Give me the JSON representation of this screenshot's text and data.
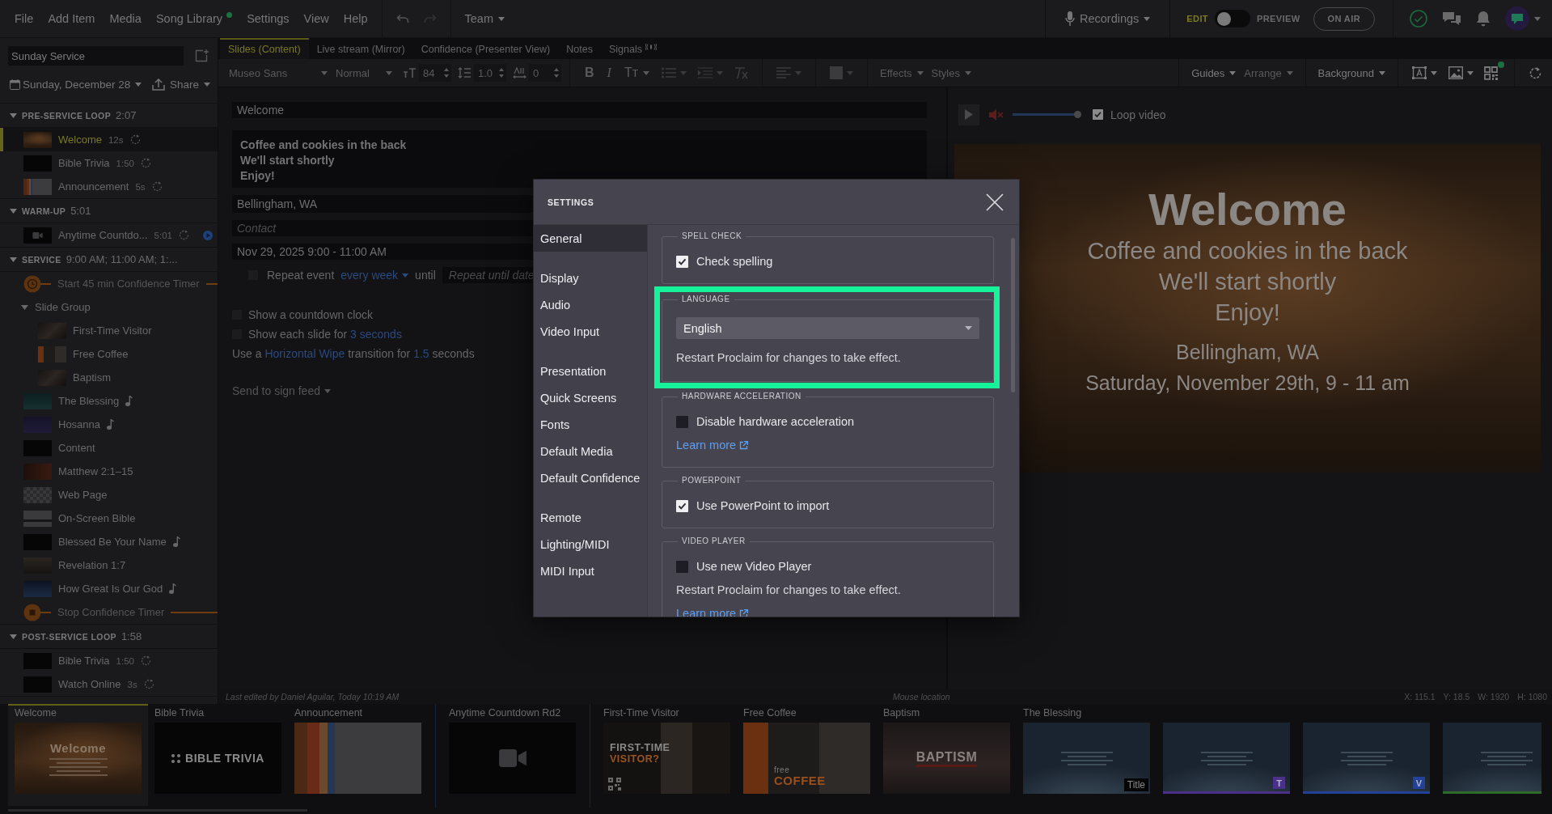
{
  "menu_bar": {
    "menus": [
      {
        "label": "File",
        "notification_dot": false
      },
      {
        "label": "Add Item",
        "notification_dot": false
      },
      {
        "label": "Media",
        "notification_dot": false
      },
      {
        "label": "Song Library",
        "notification_dot": true
      },
      {
        "label": "Settings",
        "notification_dot": false
      },
      {
        "label": "View",
        "notification_dot": false
      },
      {
        "label": "Help",
        "notification_dot": false
      }
    ],
    "team": "Team",
    "recordings": "Recordings",
    "mode": {
      "edit_label": "EDIT",
      "preview_label": "PREVIEW",
      "preview_on": false
    },
    "on_air": "ON AIR"
  },
  "sidebar": {
    "service_name": "Sunday Service",
    "date": "Sunday, December 28",
    "share": "Share",
    "sections": [
      {
        "title": "PRE-SERVICE LOOP",
        "time": "2:07",
        "expanded": true,
        "items": [
          {
            "kind": "slide",
            "label": "Welcome",
            "duration": "12s",
            "thumbnail": {
              "kind": "warm"
            },
            "loop": true,
            "playing": false,
            "selected": true
          },
          {
            "kind": "slide",
            "label": "Bible Trivia",
            "duration": "1:50",
            "thumbnail": {
              "kind": "title"
            },
            "loop": true,
            "playing": false,
            "selected": false
          },
          {
            "kind": "slide",
            "label": "Announcement",
            "duration": "5s",
            "thumbnail": {
              "kind": "poster"
            },
            "loop": true,
            "playing": false,
            "selected": false
          }
        ]
      },
      {
        "title": "WARM-UP",
        "time": "5:01",
        "expanded": true,
        "items": [
          {
            "kind": "slide",
            "label": "Anytime Countdo...",
            "duration": "5:01",
            "thumbnail": {
              "kind": "video"
            },
            "loop": true,
            "playing": true,
            "selected": false
          }
        ]
      },
      {
        "title": "SERVICE",
        "time": "9:00 AM; 11:00 AM; 1:...",
        "expanded": true,
        "items": [
          {
            "kind": "timer-start",
            "label": "Start 45 min Confidence Timer",
            "selected": false
          },
          {
            "kind": "group",
            "label": "Slide Group",
            "expanded": true,
            "selected": false,
            "children": [
              {
                "kind": "slide",
                "label": "First-Time Visitor",
                "thumbnail": {
                  "kind": "photo"
                },
                "selected": false
              },
              {
                "kind": "slide",
                "label": "Free Coffee",
                "thumbnail": {
                  "kind": "coffee"
                },
                "selected": false
              },
              {
                "kind": "slide",
                "label": "Baptism",
                "thumbnail": {
                  "kind": "photo"
                },
                "selected": false
              }
            ]
          },
          {
            "kind": "song",
            "label": "The Blessing",
            "thumbnail": {
              "kind": "teal"
            },
            "selected": false
          },
          {
            "kind": "song",
            "label": "Hosanna",
            "thumbnail": {
              "kind": "purple"
            },
            "selected": false
          },
          {
            "kind": "slide",
            "label": "Content",
            "thumbnail": {
              "kind": "title"
            },
            "selected": false
          },
          {
            "kind": "slide",
            "label": "Matthew 2:1–15",
            "thumbnail": {
              "kind": "red"
            },
            "selected": false
          },
          {
            "kind": "slide",
            "label": "Web Page",
            "thumbnail": {
              "kind": "checker"
            },
            "selected": false
          },
          {
            "kind": "slide",
            "label": "On-Screen Bible",
            "thumbnail": {
              "kind": "screen"
            },
            "selected": false
          },
          {
            "kind": "song",
            "label": "Blessed Be Your Name",
            "thumbnail": {
              "kind": "title"
            },
            "selected": false
          },
          {
            "kind": "slide",
            "label": "Revelation 1:7",
            "thumbnail": {
              "kind": "stone"
            },
            "selected": false
          },
          {
            "kind": "song",
            "label": "How Great Is Our God",
            "thumbnail": {
              "kind": "night"
            },
            "selected": false
          },
          {
            "kind": "timer-stop",
            "label": "Stop Confidence Timer",
            "selected": false
          }
        ]
      },
      {
        "title": "POST-SERVICE LOOP",
        "time": "1:58",
        "expanded": true,
        "items": [
          {
            "kind": "slide",
            "label": "Bible Trivia",
            "duration": "1:50",
            "thumbnail": {
              "kind": "title"
            },
            "loop": true,
            "playing": false,
            "selected": false
          },
          {
            "kind": "slide",
            "label": "Watch Online",
            "duration": "3s",
            "thumbnail": {
              "kind": "title"
            },
            "loop": true,
            "playing": false,
            "selected": false
          }
        ]
      }
    ]
  },
  "tabs": [
    {
      "label": "Slides (Content)",
      "selected": true
    },
    {
      "label": "Live stream (Mirror)",
      "selected": false
    },
    {
      "label": "Confidence (Presenter View)",
      "selected": false
    },
    {
      "label": "Notes",
      "selected": false
    },
    {
      "label": "Signals",
      "selected": false
    }
  ],
  "toolbar": {
    "font": {
      "value": "Museo Sans",
      "disabled": true
    },
    "paragraph_style": {
      "value": "Normal",
      "disabled": true
    },
    "spinners": [
      {
        "kind": "font-size",
        "value": "84",
        "disabled": true
      },
      {
        "kind": "line-height",
        "value": "1.0",
        "disabled": true
      },
      {
        "kind": "letter-spacing",
        "value": "0",
        "disabled": true
      }
    ],
    "format_buttons": [
      {
        "kind": "bold",
        "label": "B",
        "disabled": true
      },
      {
        "kind": "italic",
        "label": "I",
        "disabled": true
      },
      {
        "kind": "case",
        "label": "Tт",
        "disabled": true
      }
    ],
    "effects": {
      "label": "Effects",
      "disabled": true
    },
    "styles": {
      "label": "Styles",
      "disabled": true
    },
    "guides": {
      "label": "Guides",
      "disabled": false
    },
    "arrange": {
      "label": "Arrange",
      "disabled": true
    },
    "background": {
      "label": "Background",
      "disabled": false
    },
    "qr_dot": true
  },
  "editor": {
    "title": "Welcome",
    "body_lines": [
      "Coffee and cookies in the back",
      "We'll start shortly",
      "Enjoy!"
    ],
    "location": "Bellingham, WA",
    "contact_placeholder": "Contact",
    "event_time": "Nov 29, 2025 9:00 - 11:00 AM",
    "repeat": {
      "checked": false,
      "label": "Repeat event",
      "frequency": "every week",
      "until": "until",
      "until_placeholder": "Repeat until date"
    },
    "options": [
      {
        "kind": "checkbox",
        "checked": false,
        "parts": [
          {
            "text": "Show a countdown clock"
          }
        ]
      },
      {
        "kind": "checkbox",
        "checked": false,
        "parts": [
          {
            "text": "Show each slide for "
          },
          {
            "link": "3 seconds"
          }
        ]
      },
      {
        "kind": "plain",
        "parts": [
          {
            "text": "Use a "
          },
          {
            "link": "Horizontal Wipe"
          },
          {
            "text": " transition for "
          },
          {
            "link": "1.5"
          },
          {
            "text": " seconds"
          }
        ]
      }
    ],
    "sign_feed": "Send to sign feed"
  },
  "preview": {
    "muted": true,
    "volume": {
      "level": 1
    },
    "loop_video": {
      "label": "Loop video",
      "checked": true
    },
    "slide_lines": [
      {
        "kind": "title",
        "text": "Welcome"
      },
      {
        "kind": "body",
        "text": "Coffee and cookies in the back"
      },
      {
        "kind": "body",
        "text": "We'll start shortly"
      },
      {
        "kind": "body",
        "text": "Enjoy!"
      },
      {
        "kind": "detail",
        "text": "Bellingham, WA"
      },
      {
        "kind": "detail",
        "text": "Saturday, November 29th, 9 - 11 am"
      }
    ]
  },
  "status_bar": {
    "last_edited": "Last edited by Daniel Aguilar, Today 10:19 AM",
    "mouse_label": "Mouse location",
    "coordinates": [
      "X: 115.1",
      "Y: 18.5",
      "W: 1920",
      "H: 1080"
    ]
  },
  "filmstrip": {
    "groups": [
      {
        "items": [
          {
            "label": "Welcome",
            "thumbnail": {
              "kind": "warm"
            },
            "caption_lines": [
              "Welcome"
            ],
            "selected": true
          },
          {
            "label": "Bible Trivia",
            "thumbnail": {
              "kind": "trivia"
            },
            "caption_lines": [
              "BIBLE TRIVIA"
            ],
            "selected": false
          },
          {
            "label": "Announcement",
            "thumbnail": {
              "kind": "poster"
            },
            "selected": false
          }
        ]
      },
      {
        "items": [
          {
            "label": "Anytime Countdown Rd2",
            "thumbnail": {
              "kind": "video"
            },
            "selected": false
          }
        ]
      },
      {
        "items": [
          {
            "label": "First-Time Visitor",
            "thumbnail": {
              "kind": "visitor"
            },
            "caption_lines": [
              "FIRST-TIME",
              "VISITOR?"
            ],
            "selected": false
          },
          {
            "label": "Free Coffee",
            "thumbnail": {
              "kind": "coffee"
            },
            "caption_lines": [
              "free",
              "COFFEE"
            ],
            "selected": false
          },
          {
            "label": "Baptism",
            "thumbnail": {
              "kind": "baptism"
            },
            "caption_lines": [
              "BAPTISM"
            ],
            "selected": false
          },
          {
            "label": "The Blessing",
            "thumbnail": {
              "kind": "lyrics"
            },
            "tag": "Title",
            "selected": false
          },
          {
            "thumbnail": {
              "kind": "lyrics"
            },
            "badge": "T",
            "color": "#4a3088",
            "selected": false
          },
          {
            "thumbnail": {
              "kind": "lyrics"
            },
            "badge": "V",
            "color": "#22429a",
            "selected": false
          },
          {
            "thumbnail": {
              "kind": "lyrics"
            },
            "color": "#2e6a2a",
            "selected": false
          }
        ]
      }
    ]
  },
  "settings_dialog": {
    "title": "SETTINGS",
    "nav_groups": [
      [
        {
          "label": "General",
          "selected": true
        }
      ],
      [
        {
          "label": "Display",
          "selected": false
        },
        {
          "label": "Audio",
          "selected": false
        },
        {
          "label": "Video Input",
          "selected": false
        }
      ],
      [
        {
          "label": "Presentation",
          "selected": false
        },
        {
          "label": "Quick Screens",
          "selected": false
        },
        {
          "label": "Fonts",
          "selected": false
        },
        {
          "label": "Default Media",
          "selected": false
        },
        {
          "label": "Default Confidence",
          "selected": false
        }
      ],
      [
        {
          "label": "Remote",
          "selected": false
        },
        {
          "label": "Lighting/MIDI",
          "selected": false
        },
        {
          "label": "MIDI Input",
          "selected": false
        }
      ]
    ],
    "sections": [
      {
        "legend": "SPELL CHECK",
        "highlighted": false,
        "rows": [
          {
            "kind": "checkbox",
            "label": "Check spelling",
            "checked": true
          }
        ]
      },
      {
        "legend": "LANGUAGE",
        "highlighted": true,
        "rows": [
          {
            "kind": "select",
            "value": "English"
          },
          {
            "kind": "note",
            "text": "Restart Proclaim for changes to take effect."
          }
        ]
      },
      {
        "legend": "HARDWARE ACCELERATION",
        "highlighted": false,
        "rows": [
          {
            "kind": "checkbox",
            "label": "Disable hardware acceleration",
            "checked": false
          },
          {
            "kind": "link",
            "text": "Learn more"
          }
        ]
      },
      {
        "legend": "POWERPOINT",
        "highlighted": false,
        "rows": [
          {
            "kind": "checkbox",
            "label": "Use PowerPoint to import",
            "checked": true
          }
        ]
      },
      {
        "legend": "VIDEO PLAYER",
        "highlighted": false,
        "rows": [
          {
            "kind": "checkbox",
            "label": "Use new Video Player",
            "checked": false
          },
          {
            "kind": "note",
            "text": "Restart Proclaim for changes to take effect."
          },
          {
            "kind": "link",
            "text": "Learn more"
          }
        ]
      }
    ]
  }
}
